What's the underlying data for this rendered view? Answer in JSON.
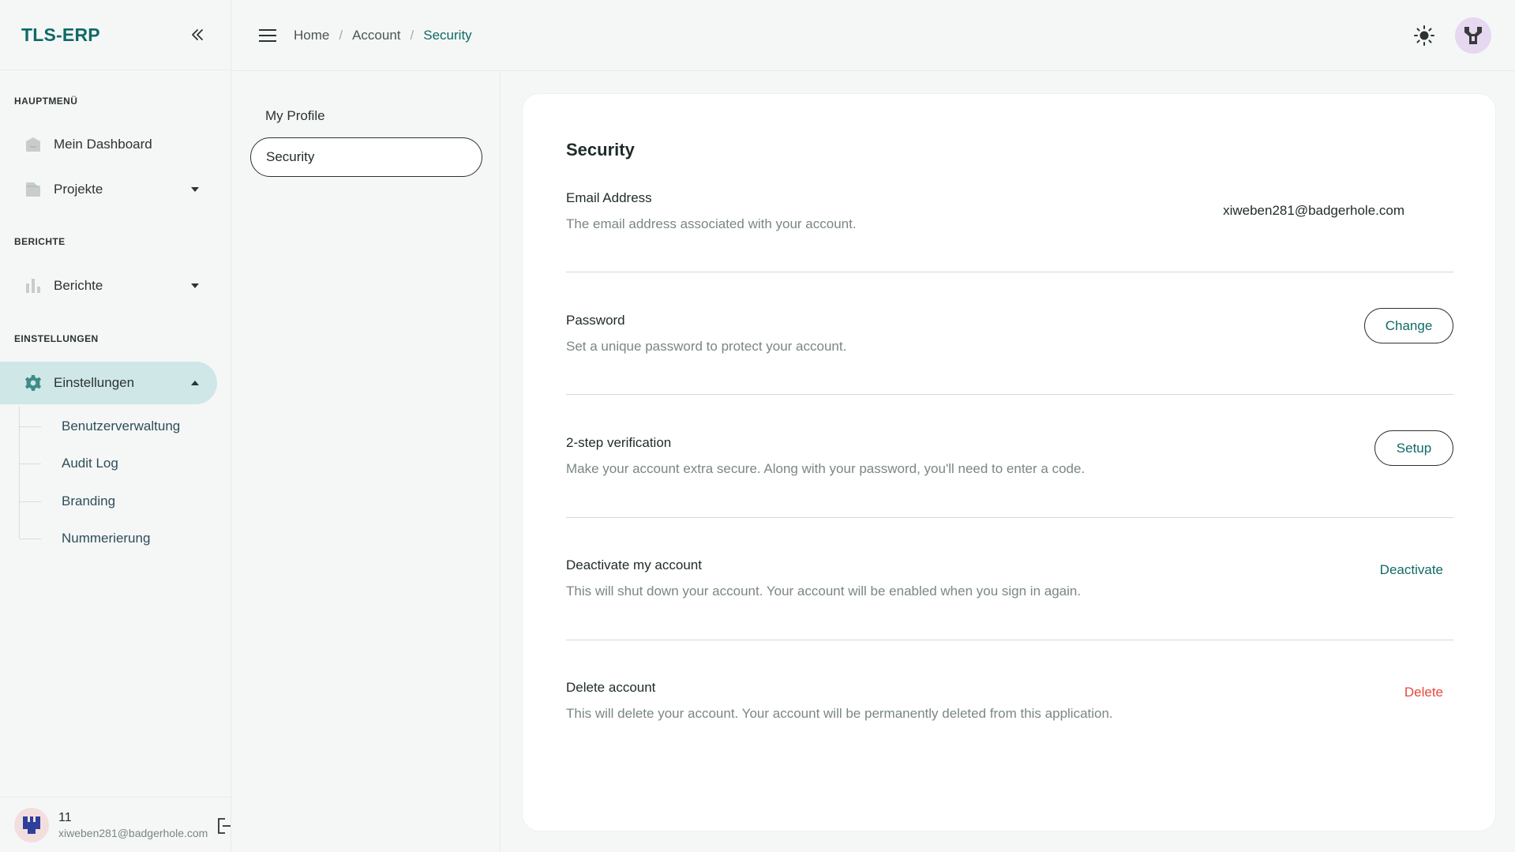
{
  "sidebar": {
    "logo": "TLS-ERP",
    "sections": {
      "main": "HAUPTMENÜ",
      "reports": "BERICHTE",
      "settings": "EINSTELLUNGEN"
    },
    "items": {
      "dashboard": "Mein Dashboard",
      "projects": "Projekte",
      "reports": "Berichte",
      "settings": "Einstellungen"
    },
    "sub_items": [
      "Benutzerverwaltung",
      "Audit Log",
      "Branding",
      "Nummerierung"
    ],
    "user": {
      "name": "11",
      "email": "xiweben281@badgerhole.com"
    }
  },
  "topbar": {
    "breadcrumb": [
      "Home",
      "Account",
      "Security"
    ]
  },
  "account_nav": {
    "items": [
      "My Profile",
      "Security"
    ],
    "active": "Security"
  },
  "security": {
    "title": "Security",
    "email": {
      "title": "Email Address",
      "description": "The email address associated with your account.",
      "value": "xiweben281@badgerhole.com"
    },
    "password": {
      "title": "Password",
      "description": "Set a unique password to protect your account.",
      "action": "Change"
    },
    "two_step": {
      "title": "2-step verification",
      "description": "Make your account extra secure. Along with your password, you'll need to enter a code.",
      "action": "Setup"
    },
    "deactivate": {
      "title": "Deactivate my account",
      "description": "This will shut down your account. Your account will be enabled when you sign in again.",
      "action": "Deactivate"
    },
    "delete": {
      "title": "Delete account",
      "description": "This will delete your account. Your account will be permanently deleted from this application.",
      "action": "Delete"
    }
  },
  "colors": {
    "brand": "#0f6a66",
    "active_bg": "#cfe7e6",
    "danger": "#e5483b"
  },
  "icons": [
    "chevrons-left-icon",
    "hamburger-menu-icon",
    "sun-icon",
    "dashboard-icon",
    "folder-icon",
    "bar-chart-icon",
    "gear-icon",
    "caret-down-icon",
    "caret-up-icon",
    "logout-icon",
    "avatar-icon"
  ]
}
